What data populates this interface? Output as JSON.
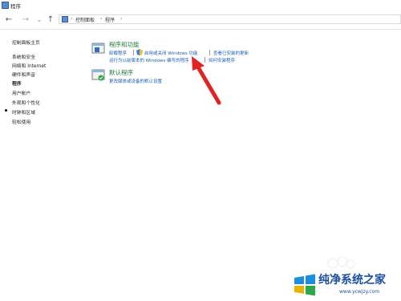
{
  "window": {
    "title": "程序"
  },
  "nav": {
    "back_glyph": "←",
    "forward_glyph": "→",
    "dropdown_glyph": "⌄",
    "up_glyph": "↑"
  },
  "breadcrumb": {
    "sep1": "›",
    "item1": "控制面板",
    "sep2": "›",
    "item2": "程序",
    "sep3": "›"
  },
  "sidebar": {
    "items": [
      {
        "label": "控制面板主页"
      },
      {
        "label": "系统和安全"
      },
      {
        "label": "网络和 Internet"
      },
      {
        "label": "硬件和声音"
      },
      {
        "label": "程序"
      },
      {
        "label": "用户帐户"
      },
      {
        "label": "外观和个性化"
      },
      {
        "label": "时钟和区域"
      },
      {
        "label": "轻松使用"
      }
    ]
  },
  "programs_features": {
    "title": "程序和功能",
    "links": {
      "uninstall": "卸载程序",
      "toggle_features": "启用或关闭 Windows 功能",
      "view_updates": "查看已安装的更新",
      "run_old": "运行为以前版本的 Windows 编写的程序",
      "how_install": "如何安装程序"
    }
  },
  "default_programs": {
    "title": "默认程序",
    "links": {
      "change_media": "更改媒体或设备的默认设置"
    }
  },
  "watermark": {
    "name": "纯净系统之家",
    "url": "www.ycwjzy.com"
  },
  "colors": {
    "link": "#1a5fb4",
    "title_green": "#1f7a3a",
    "arrow": "#e02424"
  }
}
